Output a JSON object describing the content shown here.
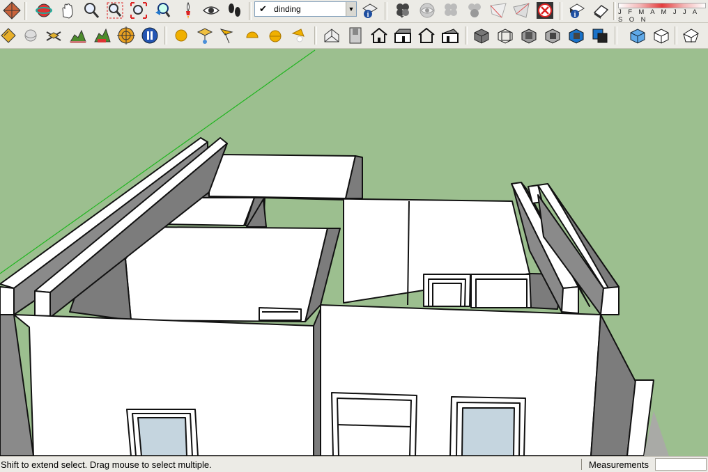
{
  "toolbar_top": {
    "left_icons": [
      "pencil-kite-icon",
      "orbit-icon",
      "pan-icon",
      "zoom-icon",
      "zoom-window-icon",
      "zoom-extents-icon",
      "previous-view-icon",
      "walk-icon",
      "look-around-icon",
      "footprints-icon"
    ],
    "layer_select": {
      "checked": true,
      "value": "dinding"
    },
    "layer_manager_icon": "layer-info-icon",
    "section_icons": [
      "add-section-icon",
      "display-sections-icon",
      "section-cuts-icon",
      "section-fill-icon",
      "section-plane-icon",
      "section-plane-2-icon",
      "close-x-icon"
    ],
    "entity_icons": [
      "entity-info-icon",
      "eraser-icon"
    ],
    "shadow_months": "J F M A M J J A S O N",
    "shadow_colors": {
      "low": "#ffffff",
      "high": "#e43c3c"
    }
  },
  "toolbar_second": {
    "left_icons": [
      "ruler-tag-icon",
      "sphere-icon",
      "sandbox-scissors-icon",
      "sandbox-terrain-icon",
      "sandbox-smoove-icon",
      "target-icon",
      "pause-icon"
    ],
    "shape_icons": [
      "yellow-ball-icon",
      "axes-icon",
      "flag-icon",
      "half-dome-icon",
      "globe-icon",
      "wedge-icon"
    ],
    "view_icons": [
      "iso-view-icon",
      "top-door-icon",
      "front-house-icon",
      "right-house-icon",
      "back-house-icon",
      "left-house-icon"
    ],
    "style_icons": [
      "xray-icon",
      "wireframe-icon",
      "hidden-line-icon",
      "shaded-icon",
      "shaded-texture-icon",
      "monochrome-icon"
    ],
    "camera_icons": [
      "parallel-projection-icon",
      "perspective-icon",
      "two-point-icon"
    ]
  },
  "viewport": {
    "sky_ground_color": "#9cbf8f",
    "axis_color": "#1fb51f",
    "wall_white": "#ffffff",
    "wall_shadow": "#7c7c7c",
    "window_glass": "#c5d5df"
  },
  "statusbar": {
    "message": "Shift to extend select. Drag mouse to select multiple.",
    "measurements_label": "Measurements",
    "measurements_value": ""
  }
}
